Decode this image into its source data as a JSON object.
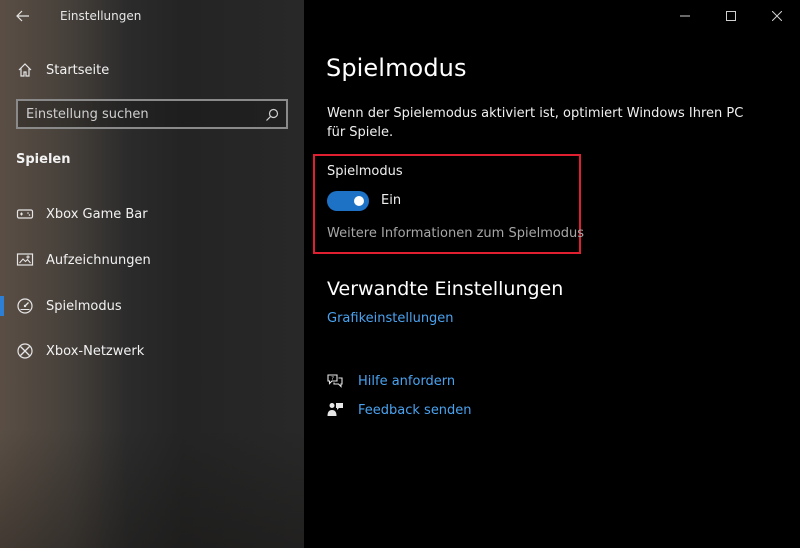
{
  "window": {
    "title": "Einstellungen"
  },
  "sidebar": {
    "home_label": "Startseite",
    "search": {
      "placeholder": "Einstellung suchen"
    },
    "section_title": "Spielen",
    "items": [
      {
        "label": "Xbox Game Bar",
        "icon": "xbox-game-bar-icon",
        "selected": false
      },
      {
        "label": "Aufzeichnungen",
        "icon": "captures-icon",
        "selected": false
      },
      {
        "label": "Spielmodus",
        "icon": "game-mode-icon",
        "selected": true
      },
      {
        "label": "Xbox-Netzwerk",
        "icon": "xbox-icon",
        "selected": false
      }
    ]
  },
  "main": {
    "title": "Spielmodus",
    "description": "Wenn der Spielemodus aktiviert ist, optimiert Windows Ihren PC für Spiele.",
    "toggle": {
      "heading": "Spielmodus",
      "state_label": "Ein",
      "on": true
    },
    "more_info_link": "Weitere Informationen zum Spielmodus",
    "related": {
      "heading": "Verwandte Einstellungen",
      "links": [
        "Grafikeinstellungen"
      ]
    },
    "help": {
      "get_help": "Hilfe anfordern",
      "feedback": "Feedback senden"
    }
  },
  "colors": {
    "accent": "#1e72c6",
    "link": "#4aa3f0",
    "highlight": "#e02030"
  }
}
